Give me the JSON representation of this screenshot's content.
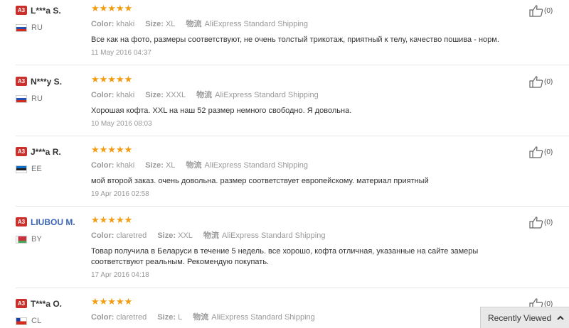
{
  "reviews": [
    {
      "badge": "A3",
      "name": "L***a S.",
      "name_link": false,
      "country": "RU",
      "flag": "ru",
      "stars": "★★★★★",
      "color_label": "Color:",
      "color": "khaki",
      "size_label": "Size:",
      "size": "XL",
      "ship_cn": "物流",
      "shipping": "AliExpress Standard Shipping",
      "text": "Все как на фото, размеры соответствуют, не очень толстый трикотаж, приятный к телу, качество пошива - норм.",
      "date": "11 May 2016 04:37",
      "helpful": "(0)"
    },
    {
      "badge": "A3",
      "name": "N***y S.",
      "name_link": false,
      "country": "RU",
      "flag": "ru",
      "stars": "★★★★★",
      "color_label": "Color:",
      "color": "khaki",
      "size_label": "Size:",
      "size": "XXXL",
      "ship_cn": "物流",
      "shipping": "AliExpress Standard Shipping",
      "text": "Хорошая кофта. XXL на наш 52 размер немного свободно. Я довольна.",
      "date": "10 May 2016 08:03",
      "helpful": "(0)"
    },
    {
      "badge": "A3",
      "name": "J***a R.",
      "name_link": false,
      "country": "EE",
      "flag": "ee",
      "stars": "★★★★★",
      "color_label": "Color:",
      "color": "khaki",
      "size_label": "Size:",
      "size": "XL",
      "ship_cn": "物流",
      "shipping": "AliExpress Standard Shipping",
      "text": "мой второй заказ. очень довольна. размер соответствует европейскому. материал приятный",
      "date": "19 Apr 2016 02:58",
      "helpful": "(0)"
    },
    {
      "badge": "A3",
      "name": "LIUBOU M.",
      "name_link": true,
      "country": "BY",
      "flag": "by",
      "stars": "★★★★★",
      "color_label": "Color:",
      "color": "claretred",
      "size_label": "Size:",
      "size": "XXL",
      "ship_cn": "物流",
      "shipping": "AliExpress Standard Shipping",
      "text": "Товар получила в Беларуси в течение 5 недель. все хорошо, кофта отличная, указанные на сайте замеры соответствуют реальным. Рекомендую покупать.",
      "date": "17 Apr 2016 04:18",
      "helpful": "(0)"
    },
    {
      "badge": "A3",
      "name": "T***a O.",
      "name_link": false,
      "country": "CL",
      "flag": "cl",
      "stars": "★★★★★",
      "color_label": "Color:",
      "color": "claretred",
      "size_label": "Size:",
      "size": "L",
      "ship_cn": "物流",
      "shipping": "AliExpress Standard Shipping",
      "text": "",
      "date": "",
      "helpful": "(0)"
    }
  ],
  "recently_viewed": {
    "label": "Recently Viewed"
  },
  "colors": {
    "star": "#f39c12",
    "badge": "#c9302c",
    "link": "#3a66b5"
  }
}
